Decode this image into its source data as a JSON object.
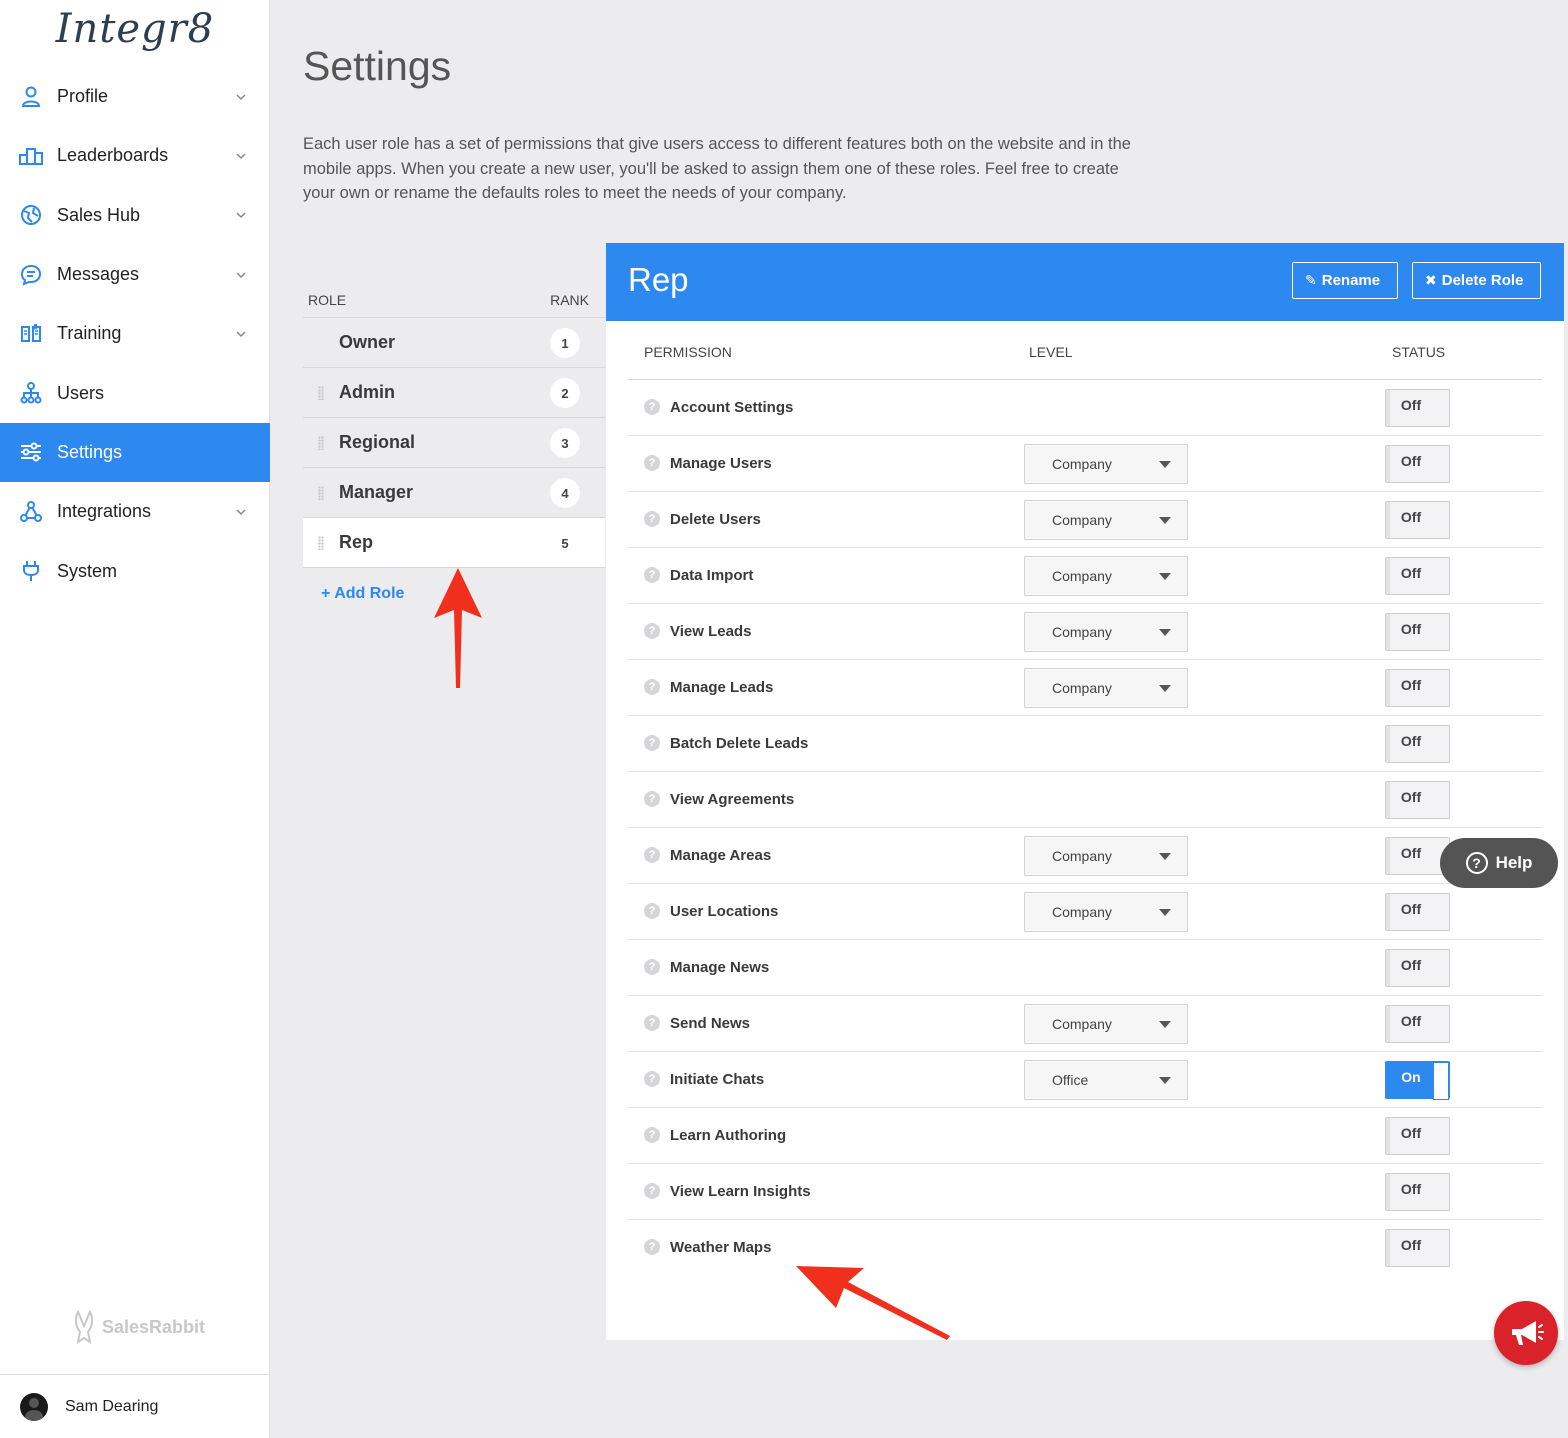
{
  "brand": {
    "logo_text": "Integr8",
    "footer_brand": "SalesRabbit"
  },
  "sidebar": {
    "items": [
      {
        "label": "Profile",
        "icon": "person-icon",
        "chevron": true
      },
      {
        "label": "Leaderboards",
        "icon": "podium-icon",
        "chevron": true
      },
      {
        "label": "Sales Hub",
        "icon": "globe-icon",
        "chevron": true
      },
      {
        "label": "Messages",
        "icon": "chat-icon",
        "chevron": true
      },
      {
        "label": "Training",
        "icon": "book-icon",
        "chevron": true
      },
      {
        "label": "Users",
        "icon": "org-chart-icon",
        "chevron": false
      },
      {
        "label": "Settings",
        "icon": "sliders-icon",
        "chevron": false,
        "active": true
      },
      {
        "label": "Integrations",
        "icon": "nodes-icon",
        "chevron": true
      },
      {
        "label": "System",
        "icon": "plug-icon",
        "chevron": false
      }
    ]
  },
  "user": {
    "name": "Sam Dearing"
  },
  "page": {
    "title": "Settings",
    "description": "Each user role has a set of permissions that give users access to different features both on the website and in the mobile apps. When you create a new user, you'll be asked to assign them one of these roles. Feel free to create your own or rename the defaults roles to meet the needs of your company."
  },
  "roles": {
    "header_role": "ROLE",
    "header_rank": "RANK",
    "items": [
      {
        "name": "Owner",
        "rank": "1"
      },
      {
        "name": "Admin",
        "rank": "2"
      },
      {
        "name": "Regional",
        "rank": "3"
      },
      {
        "name": "Manager",
        "rank": "4"
      },
      {
        "name": "Rep",
        "rank": "5",
        "selected": true
      }
    ],
    "add_label": "+ Add Role"
  },
  "panel": {
    "title": "Rep",
    "rename_label": "Rename",
    "delete_label": "Delete Role",
    "col_permission": "PERMISSION",
    "col_level": "LEVEL",
    "col_status": "STATUS",
    "permissions": [
      {
        "name": "Account Settings",
        "level": null,
        "status": "Off"
      },
      {
        "name": "Manage Users",
        "level": "Company",
        "status": "Off"
      },
      {
        "name": "Delete Users",
        "level": "Company",
        "status": "Off"
      },
      {
        "name": "Data Import",
        "level": "Company",
        "status": "Off"
      },
      {
        "name": "View Leads",
        "level": "Company",
        "status": "Off"
      },
      {
        "name": "Manage Leads",
        "level": "Company",
        "status": "Off"
      },
      {
        "name": "Batch Delete Leads",
        "level": null,
        "status": "Off"
      },
      {
        "name": "View Agreements",
        "level": null,
        "status": "Off"
      },
      {
        "name": "Manage Areas",
        "level": "Company",
        "status": "Off"
      },
      {
        "name": "User Locations",
        "level": "Company",
        "status": "Off"
      },
      {
        "name": "Manage News",
        "level": null,
        "status": "Off"
      },
      {
        "name": "Send News",
        "level": "Company",
        "status": "Off"
      },
      {
        "name": "Initiate Chats",
        "level": "Office",
        "status": "On"
      },
      {
        "name": "Learn Authoring",
        "level": null,
        "status": "Off"
      },
      {
        "name": "View Learn Insights",
        "level": null,
        "status": "Off"
      },
      {
        "name": "Weather Maps",
        "level": null,
        "status": "Off"
      }
    ]
  },
  "floating": {
    "help_label": "Help"
  },
  "colors": {
    "accent": "#2d88f0",
    "annotation_arrow": "#f0301c",
    "megaphone": "#d9222a"
  }
}
